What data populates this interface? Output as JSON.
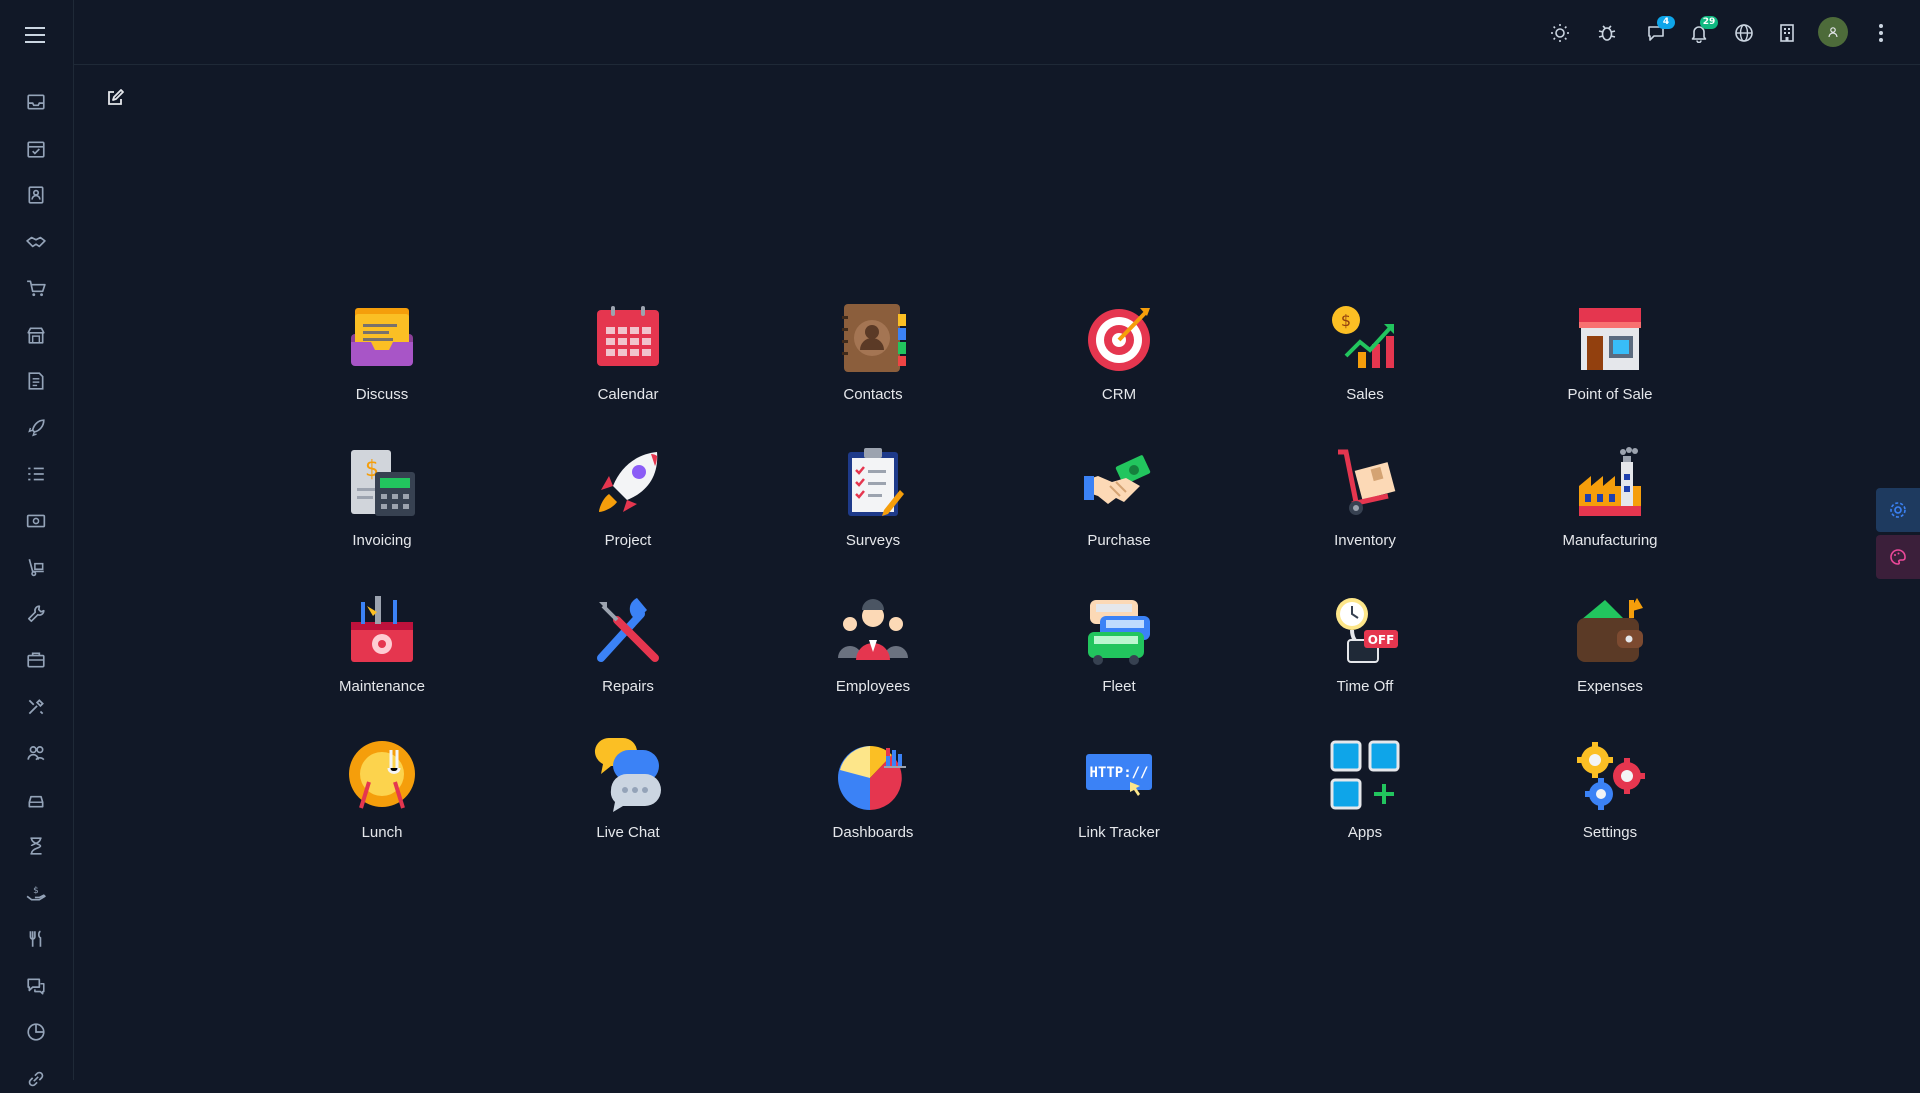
{
  "topbar": {
    "messages_badge": "4",
    "notifications_badge": "29",
    "icons": [
      "sun-icon",
      "bug-icon",
      "chat-icon",
      "bell-icon",
      "globe-icon",
      "building-icon",
      "avatar",
      "more-icon"
    ]
  },
  "sidebar": {
    "icons": [
      "inbox-icon",
      "calendar-icon",
      "contacts-icon",
      "handshake-icon",
      "cart-icon",
      "store-icon",
      "invoice-icon",
      "rocket-icon",
      "list-icon",
      "money-icon",
      "dolly-icon",
      "wrench-icon",
      "briefcase-icon",
      "tools-icon",
      "users-icon",
      "car-icon",
      "hourglass-icon",
      "hand-coin-icon",
      "utensils-icon",
      "comments-icon",
      "pie-chart-icon",
      "link-icon"
    ]
  },
  "apps": [
    {
      "label": "Discuss",
      "icon": "discuss-icon"
    },
    {
      "label": "Calendar",
      "icon": "calendar-icon"
    },
    {
      "label": "Contacts",
      "icon": "contacts-icon"
    },
    {
      "label": "CRM",
      "icon": "target-icon"
    },
    {
      "label": "Sales",
      "icon": "sales-chart-icon"
    },
    {
      "label": "Point of Sale",
      "icon": "store-icon"
    },
    {
      "label": "Invoicing",
      "icon": "invoice-calculator-icon"
    },
    {
      "label": "Project",
      "icon": "rocket-icon"
    },
    {
      "label": "Surveys",
      "icon": "clipboard-icon"
    },
    {
      "label": "Purchase",
      "icon": "handshake-money-icon"
    },
    {
      "label": "Inventory",
      "icon": "hand-truck-icon"
    },
    {
      "label": "Manufacturing",
      "icon": "factory-icon"
    },
    {
      "label": "Maintenance",
      "icon": "toolbox-icon"
    },
    {
      "label": "Repairs",
      "icon": "wrench-screwdriver-icon"
    },
    {
      "label": "Employees",
      "icon": "people-icon"
    },
    {
      "label": "Fleet",
      "icon": "cars-icon"
    },
    {
      "label": "Time Off",
      "icon": "clock-off-icon"
    },
    {
      "label": "Expenses",
      "icon": "wallet-icon"
    },
    {
      "label": "Lunch",
      "icon": "plate-utensils-icon"
    },
    {
      "label": "Live Chat",
      "icon": "chat-bubbles-icon"
    },
    {
      "label": "Dashboards",
      "icon": "pie-bar-icon"
    },
    {
      "label": "Link Tracker",
      "icon": "http-link-icon"
    },
    {
      "label": "Apps",
      "icon": "apps-grid-icon"
    },
    {
      "label": "Settings",
      "icon": "gears-icon"
    }
  ],
  "http_text": "HTTP://",
  "off_text": "OFF"
}
